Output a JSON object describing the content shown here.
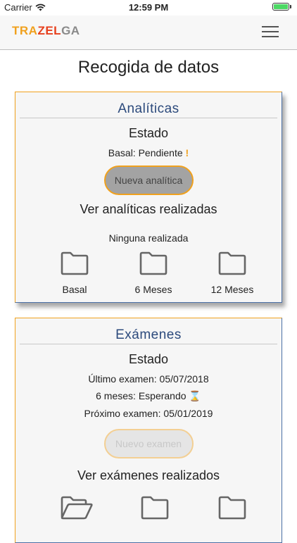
{
  "status_bar": {
    "carrier": "Carrier",
    "time": "12:59 PM"
  },
  "header": {
    "logo_part1": "TRA",
    "logo_part2": "ZEL",
    "logo_part3": "GA"
  },
  "page": {
    "title": "Recogida de datos"
  },
  "analiticas": {
    "title": "Analíticas",
    "estado_label": "Estado",
    "basal_status": "Basal: Pendiente",
    "warning_glyph": "!",
    "new_button": "Nueva analítica",
    "ver_label": "Ver analíticas realizadas",
    "none_label": "Ninguna realizada",
    "folders": [
      {
        "label": "Basal",
        "state": "closed"
      },
      {
        "label": "6 Meses",
        "state": "closed"
      },
      {
        "label": "12 Meses",
        "state": "closed"
      }
    ]
  },
  "examenes": {
    "title": "Exámenes",
    "estado_label": "Estado",
    "last_exam": "Último examen: 05/07/2018",
    "six_months": "6 meses: Esperando",
    "hourglass_glyph": "⌛",
    "next_exam": "Próximo examen: 05/01/2019",
    "new_button": "Nuevo examen",
    "ver_label": "Ver exámenes realizados",
    "folders": [
      {
        "state": "open"
      },
      {
        "state": "closed"
      },
      {
        "state": "closed"
      }
    ]
  },
  "colors": {
    "accent_orange": "#f0a11e",
    "logo_red": "#e7411f",
    "title_blue": "#2c4a7c",
    "button_gray": "#a3a3a3"
  }
}
